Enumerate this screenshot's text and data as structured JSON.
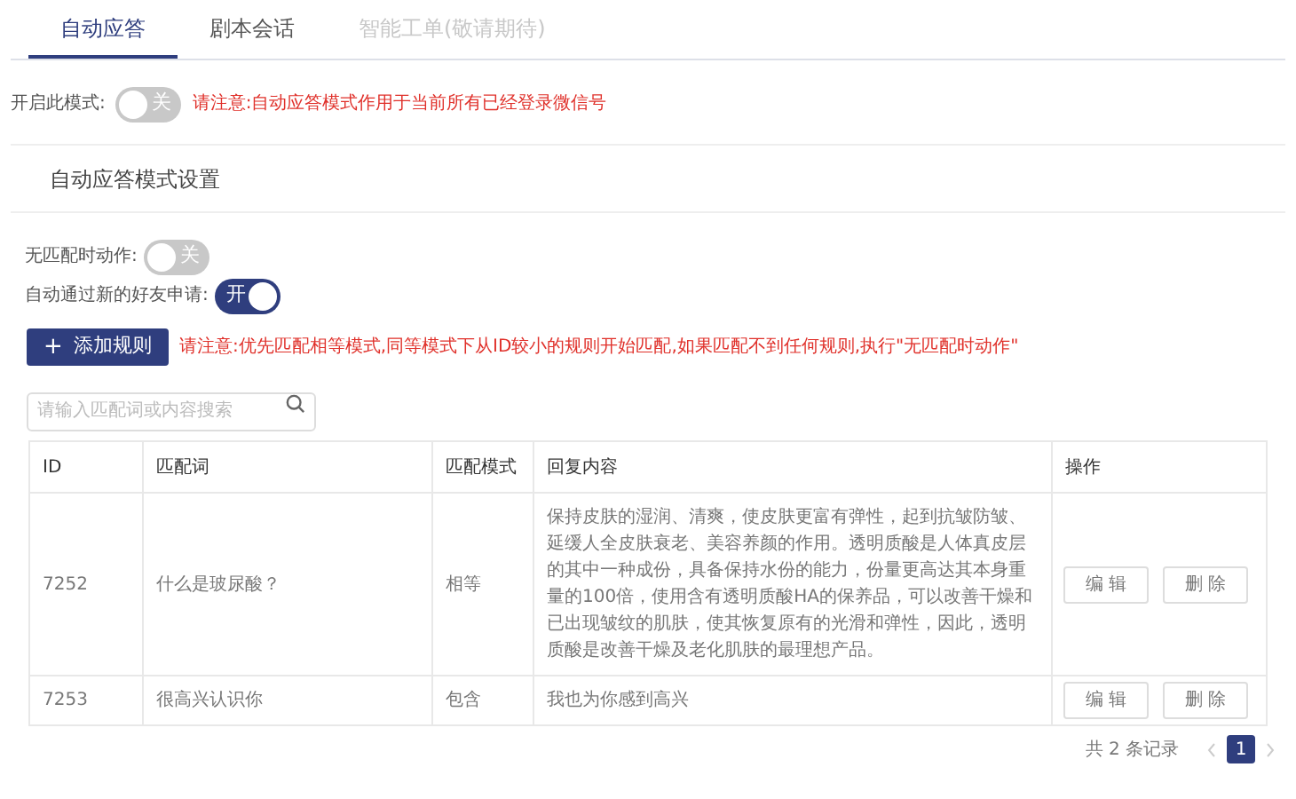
{
  "tabs": [
    {
      "label": "自动应答",
      "selected": true,
      "disabled": false
    },
    {
      "label": "剧本会话",
      "selected": false,
      "disabled": false
    },
    {
      "label": "智能工单(敬请期待)",
      "selected": false,
      "disabled": true
    }
  ],
  "mode_switch": {
    "label": "开启此模式:",
    "on": false,
    "text": "关",
    "notice": "请注意:自动应答模式作用于当前所有已经登录微信号"
  },
  "section_title": "自动应答模式设置",
  "settings": [
    {
      "label": "无匹配时动作:",
      "on": false,
      "text": "关"
    },
    {
      "label": "自动通过新的好友申请:",
      "on": true,
      "text": "开"
    }
  ],
  "add_button": {
    "icon": "+",
    "label": "添加规则"
  },
  "add_notice": "请注意:优先匹配相等模式,同等模式下从ID较小的规则开始匹配,如果匹配不到任何规则,执行\"无匹配时动作\"",
  "search": {
    "placeholder": "请输入匹配词或内容搜索"
  },
  "table": {
    "columns": [
      "ID",
      "匹配词",
      "匹配模式",
      "回复内容",
      "操作"
    ],
    "rows": [
      {
        "id": "7252",
        "keyword": "什么是玻尿酸？",
        "mode": "相等",
        "reply": "保持皮肤的湿润、清爽，使皮肤更富有弹性，起到抗皱防皱、延缓人全皮肤衰老、美容养颜的作用。透明质酸是人体真皮层的其中一种成份，具备保持水份的能力，份量更高达其本身重量的100倍，使用含有透明质酸HA的保养品，可以改善干燥和已出现皱纹的肌肤，使其恢复原有的光滑和弹性，因此，透明质酸是改善干燥及老化肌肤的最理想产品。",
        "actions": [
          "编 辑",
          "删 除"
        ]
      },
      {
        "id": "7253",
        "keyword": "很高兴认识你",
        "mode": "包含",
        "reply": "我也为你感到高兴",
        "actions": [
          "编 辑",
          "删 除"
        ]
      }
    ]
  },
  "pagination": {
    "total": "共 2 条记录",
    "pages": [
      {
        "label": "1",
        "selected": true
      }
    ]
  }
}
